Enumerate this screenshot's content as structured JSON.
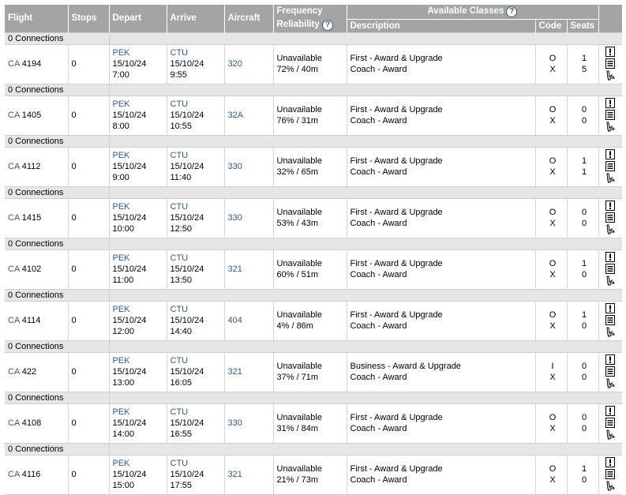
{
  "headers": {
    "flight": "Flight",
    "stops": "Stops",
    "depart": "Depart",
    "arrive": "Arrive",
    "aircraft": "Aircraft",
    "frequency": "Frequency",
    "reliability": "Reliability",
    "available_classes": "Available Classes",
    "description": "Description",
    "code": "Code",
    "seats": "Seats",
    "help_glyph": "?"
  },
  "connections_label": "0 Connections",
  "icons": [
    "alert-icon",
    "details-icon",
    "seat-icon"
  ],
  "colors": {
    "header_bg": "#a4a4a4",
    "link": "#2b5c92",
    "separator_bg": "#e6e6e6"
  },
  "flights": [
    {
      "airline": "CA",
      "number": "4194",
      "stops": "0",
      "dep_code": "PEK",
      "dep_date": "15/10/24",
      "dep_time": "7:00",
      "arr_code": "CTU",
      "arr_date": "15/10/24",
      "arr_time": "9:55",
      "aircraft": "320",
      "frequency": "Unavailable",
      "reliability": "72% / 40m",
      "desc1": "First - Award & Upgrade",
      "desc2": "Coach - Award",
      "code1": "O",
      "code2": "X",
      "seats1": "1",
      "seats2": "5"
    },
    {
      "airline": "CA",
      "number": "1405",
      "stops": "0",
      "dep_code": "PEK",
      "dep_date": "15/10/24",
      "dep_time": "8:00",
      "arr_code": "CTU",
      "arr_date": "15/10/24",
      "arr_time": "10:55",
      "aircraft": "32A",
      "frequency": "Unavailable",
      "reliability": "76% / 31m",
      "desc1": "First - Award & Upgrade",
      "desc2": "Coach - Award",
      "code1": "O",
      "code2": "X",
      "seats1": "0",
      "seats2": "0"
    },
    {
      "airline": "CA",
      "number": "4112",
      "stops": "0",
      "dep_code": "PEK",
      "dep_date": "15/10/24",
      "dep_time": "9:00",
      "arr_code": "CTU",
      "arr_date": "15/10/24",
      "arr_time": "11:40",
      "aircraft": "330",
      "frequency": "Unavailable",
      "reliability": "32% / 65m",
      "desc1": "First - Award & Upgrade",
      "desc2": "Coach - Award",
      "code1": "O",
      "code2": "X",
      "seats1": "1",
      "seats2": "1"
    },
    {
      "airline": "CA",
      "number": "1415",
      "stops": "0",
      "dep_code": "PEK",
      "dep_date": "15/10/24",
      "dep_time": "10:00",
      "arr_code": "CTU",
      "arr_date": "15/10/24",
      "arr_time": "12:50",
      "aircraft": "330",
      "frequency": "Unavailable",
      "reliability": "53% / 43m",
      "desc1": "First - Award & Upgrade",
      "desc2": "Coach - Award",
      "code1": "O",
      "code2": "X",
      "seats1": "0",
      "seats2": "0"
    },
    {
      "airline": "CA",
      "number": "4102",
      "stops": "0",
      "dep_code": "PEK",
      "dep_date": "15/10/24",
      "dep_time": "11:00",
      "arr_code": "CTU",
      "arr_date": "15/10/24",
      "arr_time": "13:50",
      "aircraft": "321",
      "frequency": "Unavailable",
      "reliability": "60% / 51m",
      "desc1": "First - Award & Upgrade",
      "desc2": "Coach - Award",
      "code1": "O",
      "code2": "X",
      "seats1": "1",
      "seats2": "0"
    },
    {
      "airline": "CA",
      "number": "4114",
      "stops": "0",
      "dep_code": "PEK",
      "dep_date": "15/10/24",
      "dep_time": "12:00",
      "arr_code": "CTU",
      "arr_date": "15/10/24",
      "arr_time": "14:40",
      "aircraft": "404",
      "frequency": "Unavailable",
      "reliability": "4% / 86m",
      "desc1": "First - Award & Upgrade",
      "desc2": "Coach - Award",
      "code1": "O",
      "code2": "X",
      "seats1": "1",
      "seats2": "0"
    },
    {
      "airline": "CA",
      "number": "422",
      "stops": "0",
      "dep_code": "PEK",
      "dep_date": "15/10/24",
      "dep_time": "13:00",
      "arr_code": "CTU",
      "arr_date": "15/10/24",
      "arr_time": "16:05",
      "aircraft": "321",
      "frequency": "Unavailable",
      "reliability": "37% / 71m",
      "desc1": "Business - Award & Upgrade",
      "desc2": "Coach - Award",
      "code1": "I",
      "code2": "X",
      "seats1": "0",
      "seats2": "0"
    },
    {
      "airline": "CA",
      "number": "4108",
      "stops": "0",
      "dep_code": "PEK",
      "dep_date": "15/10/24",
      "dep_time": "14:00",
      "arr_code": "CTU",
      "arr_date": "15/10/24",
      "arr_time": "16:55",
      "aircraft": "330",
      "frequency": "Unavailable",
      "reliability": "31% / 84m",
      "desc1": "First - Award & Upgrade",
      "desc2": "Coach - Award",
      "code1": "O",
      "code2": "X",
      "seats1": "0",
      "seats2": "0"
    },
    {
      "airline": "CA",
      "number": "4116",
      "stops": "0",
      "dep_code": "PEK",
      "dep_date": "15/10/24",
      "dep_time": "15:00",
      "arr_code": "CTU",
      "arr_date": "15/10/24",
      "arr_time": "17:55",
      "aircraft": "321",
      "frequency": "Unavailable",
      "reliability": "21% / 73m",
      "desc1": "First - Award & Upgrade",
      "desc2": "Coach - Award",
      "code1": "O",
      "code2": "X",
      "seats1": "1",
      "seats2": "0"
    }
  ]
}
